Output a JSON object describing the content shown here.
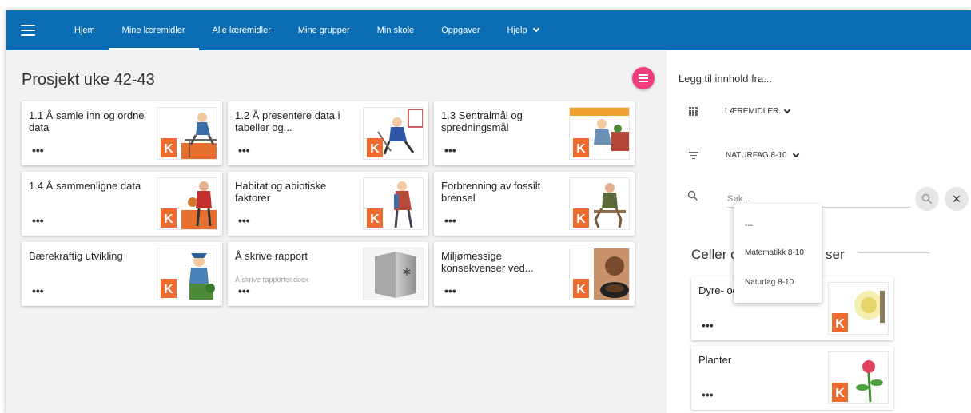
{
  "nav": {
    "items": [
      {
        "label": "Hjem",
        "active": false
      },
      {
        "label": "Mine læremidler",
        "active": true
      },
      {
        "label": "Alle læremidler",
        "active": false
      },
      {
        "label": "Mine grupper",
        "active": false
      },
      {
        "label": "Min skole",
        "active": false
      },
      {
        "label": "Oppgaver",
        "active": false
      },
      {
        "label": "Hjelp",
        "active": false
      }
    ]
  },
  "main": {
    "title": "Prosjekt uke 42-43",
    "cards": [
      {
        "title": "1.1 Å samle inn og ordne data",
        "subtitle": "",
        "menu": "•••",
        "badge": "K"
      },
      {
        "title": "1.2 Å presentere data i tabeller og...",
        "subtitle": "",
        "menu": "•••",
        "badge": "K"
      },
      {
        "title": "1.3 Sentralmål og spredningsmål",
        "subtitle": "",
        "menu": "•••",
        "badge": "K"
      },
      {
        "title": "1.4 Å sammenligne data",
        "subtitle": "",
        "menu": "•••",
        "badge": "K"
      },
      {
        "title": "Habitat og abiotiske faktorer",
        "subtitle": "",
        "menu": "•••",
        "badge": "K"
      },
      {
        "title": "Forbrenning av fossilt brensel",
        "subtitle": "",
        "menu": "•••",
        "badge": "K"
      },
      {
        "title": "Bærekraftig utvikling",
        "subtitle": "",
        "menu": "•••",
        "badge": "K"
      },
      {
        "title": "Å skrive rapport",
        "subtitle": "Å skrive rapporter.docx",
        "menu": "•••",
        "badge": "*"
      },
      {
        "title": "Miljømessige konsekvenser ved...",
        "subtitle": "",
        "menu": "•••",
        "badge": "K"
      }
    ]
  },
  "side": {
    "heading": "Legg til innhold fra...",
    "source_label": "LÆREMIDLER",
    "subject_label": "NATURFAG 8-10",
    "search_placeholder": "Søk...",
    "close_label": "×",
    "section_title": "Celler og",
    "section_title_tail": "ser",
    "cards": [
      {
        "title": "Dyre- og",
        "menu": "•••",
        "badge": "K"
      },
      {
        "title": "Planter",
        "menu": "•••",
        "badge": "K"
      }
    ]
  },
  "dropdown": {
    "options": [
      "---",
      "Matematikk 8-10",
      "Naturfag 8-10"
    ]
  },
  "colors": {
    "nav_bg": "#0a6db4",
    "fab": "#ef3d7f",
    "badge": "#ef6a2e"
  }
}
